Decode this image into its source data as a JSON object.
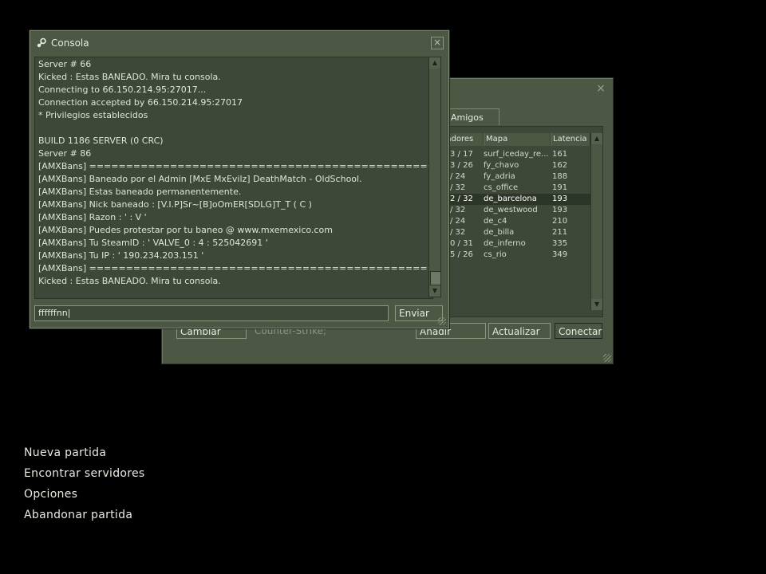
{
  "browser": {
    "close_glyph": "×",
    "tab_amigos": "Amigos",
    "columns": {
      "players": "gadores",
      "map": "Mapa",
      "latency": "Latencia"
    },
    "rows": [
      {
        "players": "3 / 17",
        "map": "surf_iceday_re...",
        "latency": "161"
      },
      {
        "players": "3 / 26",
        "map": "fy_chavo",
        "latency": "162"
      },
      {
        "players": "/ 24",
        "map": "fy_adria",
        "latency": "188"
      },
      {
        "players": "/ 32",
        "map": "cs_office",
        "latency": "191"
      },
      {
        "players": "2 / 32",
        "map": "de_barcelona",
        "latency": "193"
      },
      {
        "players": "/ 32",
        "map": "de_westwood",
        "latency": "193"
      },
      {
        "players": "/ 24",
        "map": "de_c4",
        "latency": "210"
      },
      {
        "players": "/ 32",
        "map": "de_billa",
        "latency": "211"
      },
      {
        "players": "0 / 31",
        "map": "de_inferno",
        "latency": "335"
      },
      {
        "players": "5 / 26",
        "map": "cs_rio",
        "latency": "349"
      }
    ],
    "change_filters": "Cambiar filtros",
    "game_filter": "Counter-Strike;",
    "add_server": "Añadir servidor",
    "refresh": "Actualizar",
    "connect": "Conectar"
  },
  "console": {
    "title": "Consola",
    "close_glyph": "×",
    "lines": [
      "Server # 66",
      "Kicked : Estas BANEADO. Mira tu consola.",
      "Connecting to 66.150.214.95:27017...",
      "Connection accepted by 66.150.214.95:27017",
      "* Privilegios establecidos",
      "",
      "BUILD 1186 SERVER (0 CRC)",
      "Server # 86",
      "[AMXBans] ================================================",
      "[AMXBans] Baneado por el Admin [MxE MxEvilz] DeathMatch - OldSchool.",
      "[AMXBans] Estas baneado permanentemente.",
      "[AMXBans] Nick baneado : [V.I.P]Sr~[B]oOmER[SDLG]T_T ( C )",
      "[AMXBans] Razon : ' : V '",
      "[AMXBans] Puedes protestar por tu baneo @ www.mxemexico.com",
      "[AMXBans] Tu SteamID : ' VALVE_0 : 4 : 525042691 '",
      "[AMXBans] Tu IP : ' 190.234.203.151 '",
      "[AMXBans] ================================================",
      "Kicked : Estas BANEADO. Mira tu consola."
    ],
    "input_value": "ffffffnn|",
    "send_label": "Enviar"
  },
  "menu": [
    "Nueva partida",
    "Encontrar servidores",
    "Opciones",
    "Abandonar partida"
  ]
}
